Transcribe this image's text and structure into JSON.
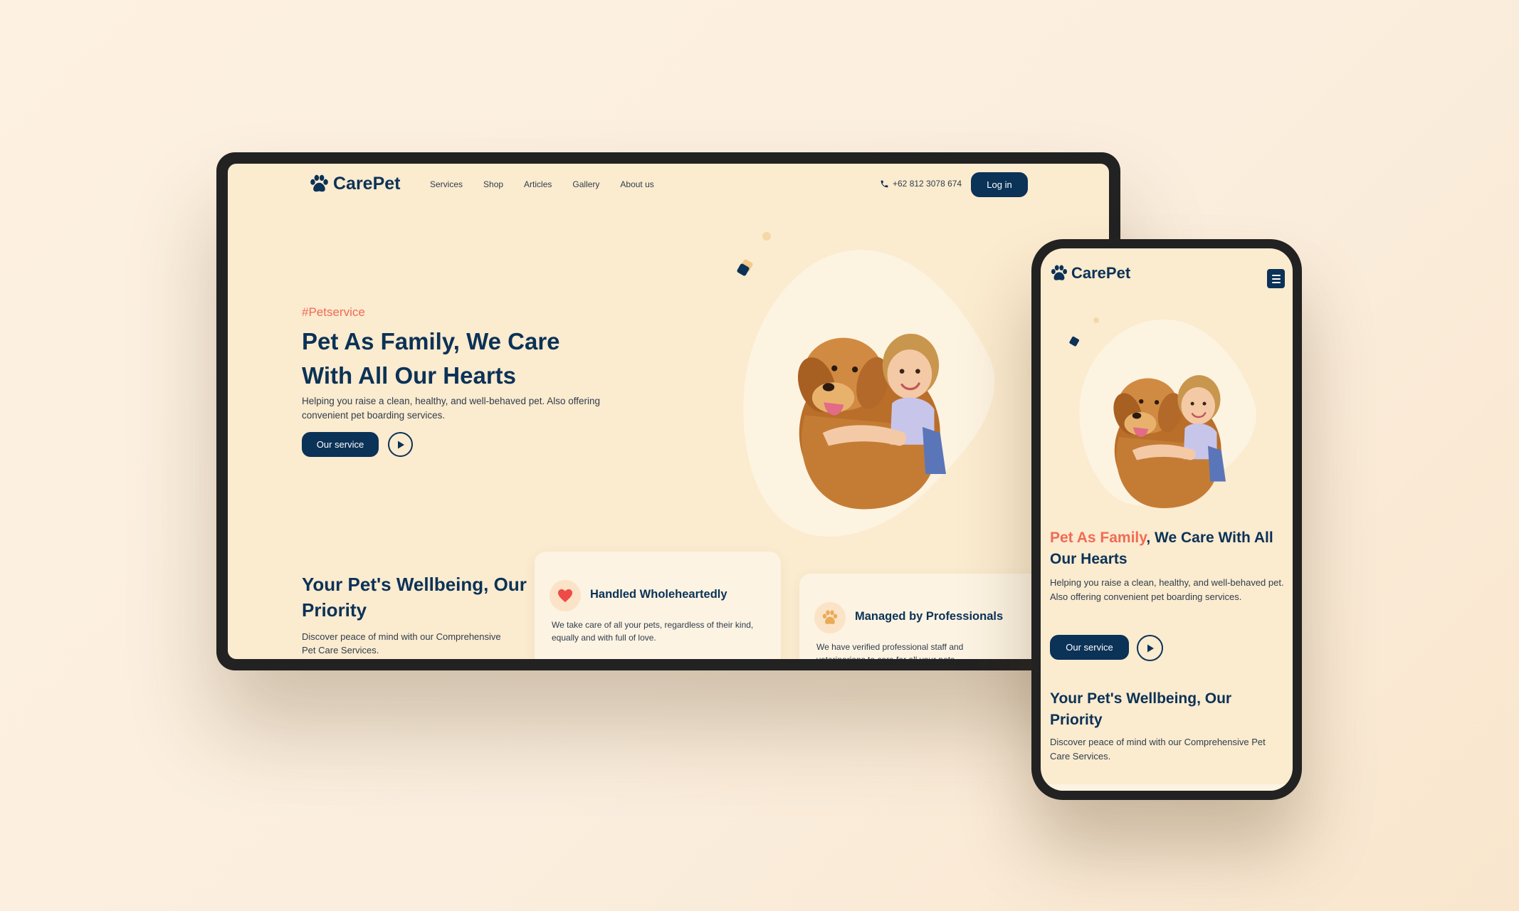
{
  "brand": {
    "name": "CarePet"
  },
  "desktop": {
    "nav": [
      "Services",
      "Shop",
      "Articles",
      "Gallery",
      "About us"
    ],
    "phone_number": "+62 812 3078 674",
    "login_label": "Log in",
    "hero": {
      "hashtag": "#Petservice",
      "title": "Pet As Family, We Care With All Our Hearts",
      "description": "Helping you raise a clean, healthy, and well-behaved pet. Also offering convenient pet boarding services.",
      "cta_label": "Our service"
    },
    "wellbeing": {
      "title": "Your Pet's Wellbeing, Our Priority",
      "subtitle": "Discover peace of mind with our Comprehensive Pet Care Services."
    },
    "features": [
      {
        "title": "Handled Wholeheartedly",
        "text": "We take care of all your pets, regardless of their kind, equally and with full of love.",
        "icon": "heart-icon"
      },
      {
        "title": "Managed by Professionals",
        "text": "We have verified professional staff and veterinarians to care for all your pets.",
        "icon": "paw-icon"
      }
    ]
  },
  "mobile": {
    "hero": {
      "title_accent": "Pet As Family",
      "title_rest": ", We Care With All Our Hearts",
      "description": "Helping you raise a clean, healthy, and well-behaved pet. Also offering convenient pet boarding services.",
      "cta_label": "Our service"
    },
    "wellbeing": {
      "title": "Your Pet's Wellbeing, Our Priority",
      "subtitle": "Discover peace of mind with our Comprehensive Pet Care Services."
    }
  },
  "colors": {
    "navy": "#0b3257",
    "accent": "#f06b56",
    "cream": "#fbebcf",
    "blob": "#fdf3e1"
  }
}
